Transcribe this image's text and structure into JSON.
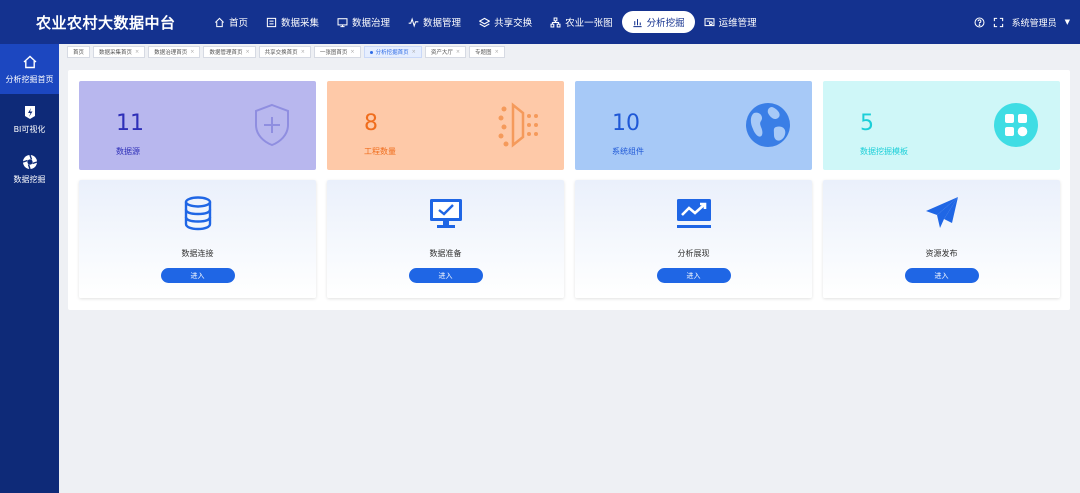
{
  "app": {
    "title": "农业农村大数据中台"
  },
  "topnav": [
    {
      "label": "首页",
      "icon": "home-icon"
    },
    {
      "label": "数据采集",
      "icon": "data-collect-icon"
    },
    {
      "label": "数据治理",
      "icon": "monitor-icon"
    },
    {
      "label": "数据管理",
      "icon": "pulse-icon"
    },
    {
      "label": "共享交换",
      "icon": "layers-icon"
    },
    {
      "label": "农业一张图",
      "icon": "org-chart-icon"
    },
    {
      "label": "分析挖掘",
      "icon": "bar-chart-icon",
      "active": true
    },
    {
      "label": "运维管理",
      "icon": "ops-icon"
    }
  ],
  "header_right": {
    "user": "系统管理员"
  },
  "sidebar": [
    {
      "label": "分析挖掘首页",
      "icon": "home-outline-icon",
      "active": true
    },
    {
      "label": "BI可视化",
      "icon": "bi-icon"
    },
    {
      "label": "数据挖掘",
      "icon": "aperture-icon"
    }
  ],
  "tabs": [
    {
      "label": "首页",
      "closable": false
    },
    {
      "label": "数据采集首页"
    },
    {
      "label": "数据治理首页"
    },
    {
      "label": "数据管理首页"
    },
    {
      "label": "共享交换首页"
    },
    {
      "label": "一张图首页"
    },
    {
      "label": "分析挖掘首页",
      "active": true
    },
    {
      "label": "资产大厅"
    },
    {
      "label": "专题图"
    }
  ],
  "stats": [
    {
      "value": "11",
      "label": "数据源",
      "bg": "#b8b7ee",
      "fg": "#2e2fb8",
      "icon": "shield-plus-icon"
    },
    {
      "value": "8",
      "label": "工程数量",
      "bg": "#fec9a8",
      "fg": "#f06d1d",
      "icon": "beam-icon"
    },
    {
      "value": "10",
      "label": "系统组件",
      "bg": "#a7c9f7",
      "fg": "#1f58d6",
      "icon": "globe-icon"
    },
    {
      "value": "5",
      "label": "数据挖掘模板",
      "bg": "#cff7f8",
      "fg": "#1ccfd8",
      "icon": "modules-icon"
    }
  ],
  "features": [
    {
      "title": "数据连接",
      "button": "进入",
      "icon": "database-icon"
    },
    {
      "title": "数据准备",
      "button": "进入",
      "icon": "monitor-check-icon"
    },
    {
      "title": "分析展现",
      "button": "进入",
      "icon": "trend-chart-icon"
    },
    {
      "title": "资源发布",
      "button": "进入",
      "icon": "paper-plane-icon"
    }
  ]
}
